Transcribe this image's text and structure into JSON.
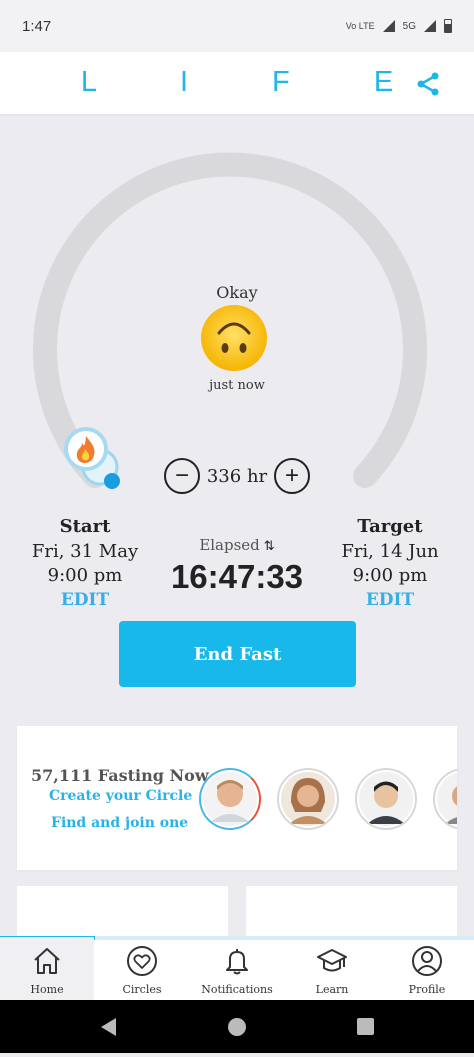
{
  "status_bar": {
    "time": "1:47",
    "volte": "Vo LTE",
    "network": "5G"
  },
  "header": {
    "logo": "L I F E"
  },
  "fast": {
    "mood_label": "Okay",
    "mood_time": "just now",
    "hours": "336 hr",
    "minus_symbol": "−",
    "plus_symbol": "+",
    "start": {
      "heading": "Start",
      "date": "Fri, 31 May",
      "time": "9:00 pm",
      "edit": "EDIT"
    },
    "target": {
      "heading": "Target",
      "date": "Fri, 14 Jun",
      "time": "9:00 pm",
      "edit": "EDIT"
    },
    "elapsed_label": "Elapsed",
    "elapsed_toggle": "⇅",
    "elapsed_time": "16:47:33",
    "end_button": "End Fast"
  },
  "circles_card": {
    "count_text": "57,111 Fasting Now",
    "create_link": "Create your Circle",
    "join_link": "Find and join one"
  },
  "bottom_nav": {
    "items": [
      {
        "label": "Home",
        "icon": "home-icon"
      },
      {
        "label": "Circles",
        "icon": "heart-circle-icon"
      },
      {
        "label": "Notifications",
        "icon": "bell-icon"
      },
      {
        "label": "Learn",
        "icon": "graduation-cap-icon"
      },
      {
        "label": "Profile",
        "icon": "profile-icon"
      }
    ]
  },
  "colors": {
    "accent": "#18b8ea",
    "dial_track": "#d9d9dc",
    "background": "#ebebf0"
  }
}
